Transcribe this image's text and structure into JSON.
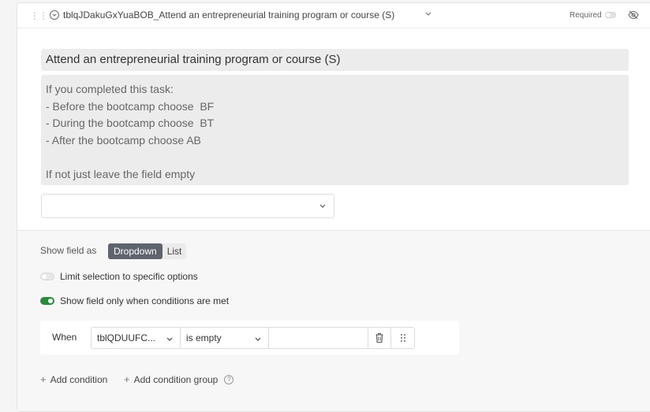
{
  "field": {
    "title": "tblqJDakuGxYuaBOB_Attend an entrepreneurial training program or course (S)",
    "required_label": "Required"
  },
  "question": {
    "title": "Attend an entrepreneurial training program or course (S)",
    "description_lines": [
      "If you completed this task:",
      "- Before the bootcamp choose  BF",
      "- During the bootcamp choose  BT",
      "- After the bootcamp choose AB",
      "",
      "If not just leave the field empty"
    ],
    "answer_value": ""
  },
  "settings": {
    "show_field_as_label": "Show field as",
    "display_options": [
      "Dropdown",
      "List"
    ],
    "display_selected": "Dropdown",
    "limit_selection_label": "Limit selection to specific options",
    "limit_selection_on": false,
    "conditions_label": "Show field only when conditions are met",
    "conditions_on": true,
    "condition": {
      "when_label": "When",
      "field": "tblQDUUFC...",
      "operator": "is empty",
      "value": ""
    },
    "add_condition_label": "Add condition",
    "add_condition_group_label": "Add condition group"
  },
  "colors": {
    "toggle_on": "#2c8a3c",
    "segment_active": "#5f636e"
  },
  "icons": {
    "header": [
      "drag-handle-icon",
      "single-select-icon",
      "chevron-down-icon",
      "eye-off-icon"
    ],
    "condition": [
      "chevron-down-icon",
      "trash-icon",
      "drag-handle-icon"
    ],
    "help": "question-circle-icon"
  }
}
